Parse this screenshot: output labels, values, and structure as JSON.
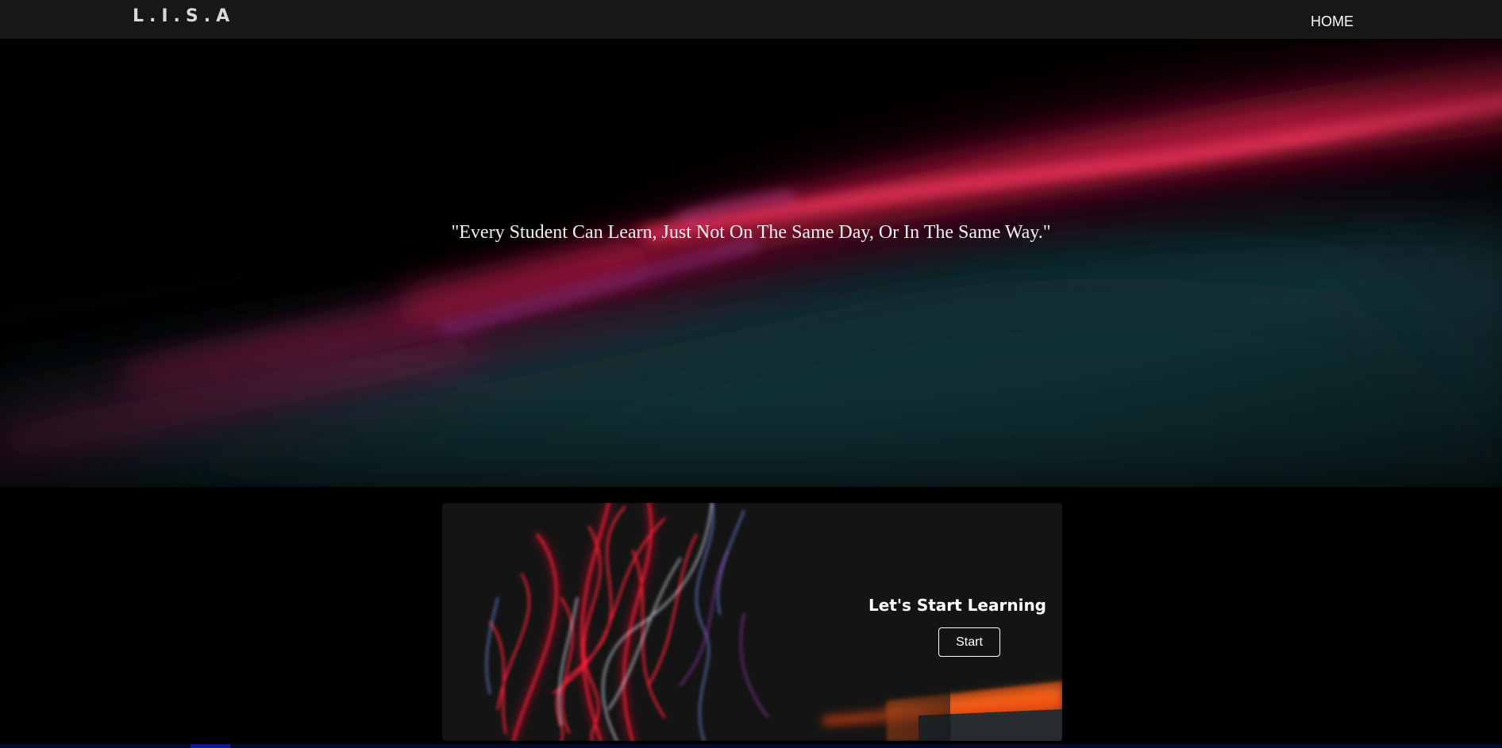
{
  "navbar": {
    "brand": "L.I.S.A",
    "home_label": "HOME"
  },
  "hero": {
    "quote": "\"Every Student Can Learn, Just Not On The Same Day, Or In The Same Way.\""
  },
  "card": {
    "title": "Let's Start Learning",
    "button_label": "Start"
  },
  "colors": {
    "navbar_bg": "#171717",
    "page_bg": "#000000",
    "card_bg": "#141414",
    "accent_red": "#e8234a",
    "accent_teal": "#1d4a52"
  }
}
